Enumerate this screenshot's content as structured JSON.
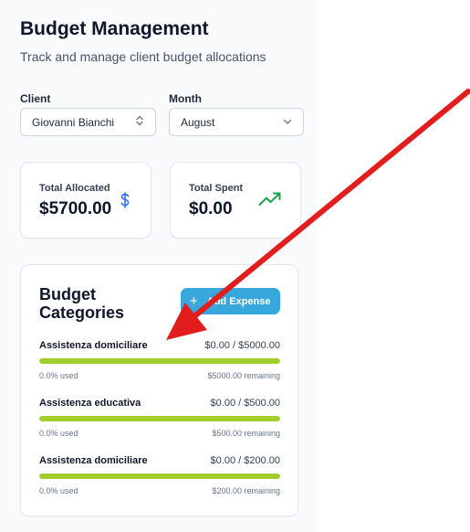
{
  "header": {
    "title": "Budget Management",
    "subtitle": "Track and manage client budget allocations"
  },
  "filters": {
    "client_label": "Client",
    "client_value": "Giovanni Bianchi",
    "month_label": "Month",
    "month_value": "August"
  },
  "stats": {
    "total_allocated_label": "Total Allocated",
    "total_allocated_value": "$5700.00",
    "total_allocated_icon": "dollar-icon",
    "total_spent_label": "Total Spent",
    "total_spent_value": "$0.00",
    "total_spent_icon": "trending-up-icon"
  },
  "categories": {
    "title": "Budget Categories",
    "add_button_label": "Add Expense",
    "items": [
      {
        "name": "Assistenza domiciliare",
        "amount": "$0.00 / $5000.00",
        "used": "0.0% used",
        "remaining": "$5000.00 remaining",
        "fill": 1.0
      },
      {
        "name": "Assistenza educativa",
        "amount": "$0.00 / $500.00",
        "used": "0.0% used",
        "remaining": "$500.00 remaining",
        "fill": 1.0
      },
      {
        "name": "Assistenza domiciliare",
        "amount": "$0.00 / $200.00",
        "used": "0.0% used",
        "remaining": "$200.00 remaining",
        "fill": 1.0
      }
    ]
  },
  "colors": {
    "accent": "#38a7dc",
    "progress": "#a3cc2d",
    "spent_icon": "#16a34a",
    "allocated_icon": "#2563eb",
    "annotation_arrow": "#e11d1d"
  }
}
